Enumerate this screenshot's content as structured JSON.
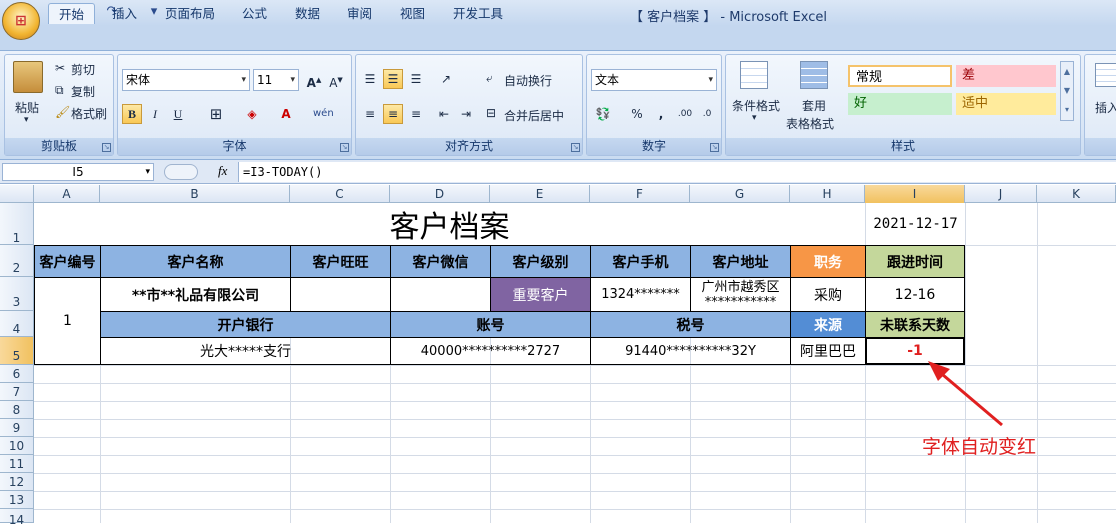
{
  "window": {
    "title": "【 客户档案 】 - Microsoft Excel"
  },
  "tabs": [
    "开始",
    "插入",
    "页面布局",
    "公式",
    "数据",
    "审阅",
    "视图",
    "开发工具"
  ],
  "clipboard": {
    "paste": "粘贴",
    "cut": "剪切",
    "copy": "复制",
    "format_painter": "格式刷",
    "label": "剪贴板"
  },
  "font": {
    "name": "宋体",
    "size": "11",
    "bold": "B",
    "italic": "I",
    "underline": "U",
    "label": "字体"
  },
  "alignment": {
    "wrap": "自动换行",
    "merge": "合并后居中",
    "label": "对齐方式"
  },
  "number": {
    "format": "文本",
    "percent": "%",
    "comma": ",",
    "label": "数字"
  },
  "styles": {
    "cond_format": "条件格式",
    "table_format_1": "套用",
    "table_format_2": "表格格式",
    "normal": "常规",
    "bad": "差",
    "good": "好",
    "neutral": "适中",
    "label": "样式"
  },
  "cells_group": {
    "insert": "插入"
  },
  "formula_bar": {
    "name_box": "I5",
    "fx": "fx",
    "formula": "=I3-TODAY()"
  },
  "columns": [
    "A",
    "B",
    "C",
    "D",
    "E",
    "F",
    "G",
    "H",
    "I",
    "J",
    "K"
  ],
  "rows": [
    "1",
    "2",
    "3",
    "4",
    "5",
    "6",
    "7",
    "8",
    "9",
    "10",
    "11",
    "12",
    "13",
    "14"
  ],
  "sheet": {
    "title": "客户档案",
    "date": "2021-12-17",
    "headers": {
      "id": "客户编号",
      "name": "客户名称",
      "wangwang": "客户旺旺",
      "wechat": "客户微信",
      "level": "客户级别",
      "phone": "客户手机",
      "address": "客户地址",
      "position": "职务",
      "follow": "跟进时间"
    },
    "row3": {
      "id": "1",
      "name": "**市**礼品有限公司",
      "level": "重要客户",
      "phone": "1324*******",
      "address_1": "广州市越秀区",
      "address_2": "***********",
      "position": "采购",
      "follow": "12-16"
    },
    "headers2": {
      "bank": "开户银行",
      "account": "账号",
      "tax": "税号",
      "source": "来源",
      "days": "未联系天数"
    },
    "row5": {
      "bank": "光大*****支行",
      "account": "40000**********2727",
      "tax": "91440**********32Y",
      "source": "阿里巴巴",
      "days": "-1"
    }
  },
  "annotation": "字体自动变红",
  "colors": {
    "header_blue": "#8db3e2",
    "orange": "#f79646",
    "green": "#c4d79b",
    "purple": "#8064a2",
    "source_blue": "#538dd5",
    "red": "#e02020"
  }
}
